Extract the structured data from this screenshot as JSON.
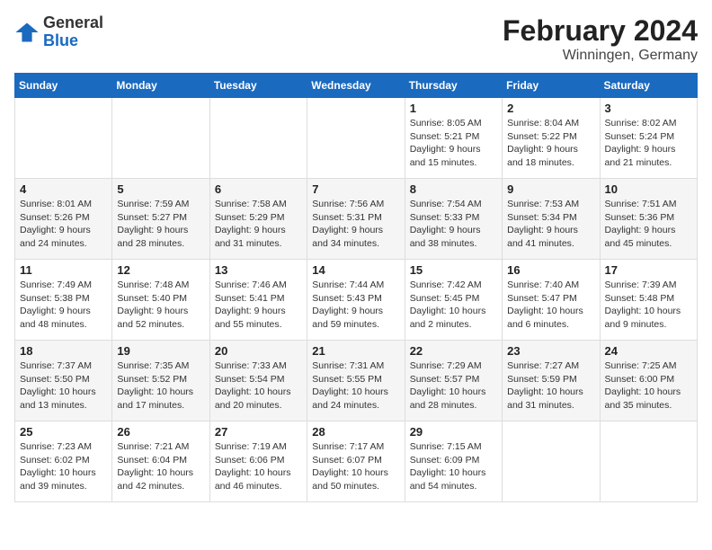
{
  "logo": {
    "text_general": "General",
    "text_blue": "Blue"
  },
  "title": "February 2024",
  "subtitle": "Winningen, Germany",
  "header_days": [
    "Sunday",
    "Monday",
    "Tuesday",
    "Wednesday",
    "Thursday",
    "Friday",
    "Saturday"
  ],
  "weeks": [
    [
      {
        "day": "",
        "info": ""
      },
      {
        "day": "",
        "info": ""
      },
      {
        "day": "",
        "info": ""
      },
      {
        "day": "",
        "info": ""
      },
      {
        "day": "1",
        "info": "Sunrise: 8:05 AM\nSunset: 5:21 PM\nDaylight: 9 hours and 15 minutes."
      },
      {
        "day": "2",
        "info": "Sunrise: 8:04 AM\nSunset: 5:22 PM\nDaylight: 9 hours and 18 minutes."
      },
      {
        "day": "3",
        "info": "Sunrise: 8:02 AM\nSunset: 5:24 PM\nDaylight: 9 hours and 21 minutes."
      }
    ],
    [
      {
        "day": "4",
        "info": "Sunrise: 8:01 AM\nSunset: 5:26 PM\nDaylight: 9 hours and 24 minutes."
      },
      {
        "day": "5",
        "info": "Sunrise: 7:59 AM\nSunset: 5:27 PM\nDaylight: 9 hours and 28 minutes."
      },
      {
        "day": "6",
        "info": "Sunrise: 7:58 AM\nSunset: 5:29 PM\nDaylight: 9 hours and 31 minutes."
      },
      {
        "day": "7",
        "info": "Sunrise: 7:56 AM\nSunset: 5:31 PM\nDaylight: 9 hours and 34 minutes."
      },
      {
        "day": "8",
        "info": "Sunrise: 7:54 AM\nSunset: 5:33 PM\nDaylight: 9 hours and 38 minutes."
      },
      {
        "day": "9",
        "info": "Sunrise: 7:53 AM\nSunset: 5:34 PM\nDaylight: 9 hours and 41 minutes."
      },
      {
        "day": "10",
        "info": "Sunrise: 7:51 AM\nSunset: 5:36 PM\nDaylight: 9 hours and 45 minutes."
      }
    ],
    [
      {
        "day": "11",
        "info": "Sunrise: 7:49 AM\nSunset: 5:38 PM\nDaylight: 9 hours and 48 minutes."
      },
      {
        "day": "12",
        "info": "Sunrise: 7:48 AM\nSunset: 5:40 PM\nDaylight: 9 hours and 52 minutes."
      },
      {
        "day": "13",
        "info": "Sunrise: 7:46 AM\nSunset: 5:41 PM\nDaylight: 9 hours and 55 minutes."
      },
      {
        "day": "14",
        "info": "Sunrise: 7:44 AM\nSunset: 5:43 PM\nDaylight: 9 hours and 59 minutes."
      },
      {
        "day": "15",
        "info": "Sunrise: 7:42 AM\nSunset: 5:45 PM\nDaylight: 10 hours and 2 minutes."
      },
      {
        "day": "16",
        "info": "Sunrise: 7:40 AM\nSunset: 5:47 PM\nDaylight: 10 hours and 6 minutes."
      },
      {
        "day": "17",
        "info": "Sunrise: 7:39 AM\nSunset: 5:48 PM\nDaylight: 10 hours and 9 minutes."
      }
    ],
    [
      {
        "day": "18",
        "info": "Sunrise: 7:37 AM\nSunset: 5:50 PM\nDaylight: 10 hours and 13 minutes."
      },
      {
        "day": "19",
        "info": "Sunrise: 7:35 AM\nSunset: 5:52 PM\nDaylight: 10 hours and 17 minutes."
      },
      {
        "day": "20",
        "info": "Sunrise: 7:33 AM\nSunset: 5:54 PM\nDaylight: 10 hours and 20 minutes."
      },
      {
        "day": "21",
        "info": "Sunrise: 7:31 AM\nSunset: 5:55 PM\nDaylight: 10 hours and 24 minutes."
      },
      {
        "day": "22",
        "info": "Sunrise: 7:29 AM\nSunset: 5:57 PM\nDaylight: 10 hours and 28 minutes."
      },
      {
        "day": "23",
        "info": "Sunrise: 7:27 AM\nSunset: 5:59 PM\nDaylight: 10 hours and 31 minutes."
      },
      {
        "day": "24",
        "info": "Sunrise: 7:25 AM\nSunset: 6:00 PM\nDaylight: 10 hours and 35 minutes."
      }
    ],
    [
      {
        "day": "25",
        "info": "Sunrise: 7:23 AM\nSunset: 6:02 PM\nDaylight: 10 hours and 39 minutes."
      },
      {
        "day": "26",
        "info": "Sunrise: 7:21 AM\nSunset: 6:04 PM\nDaylight: 10 hours and 42 minutes."
      },
      {
        "day": "27",
        "info": "Sunrise: 7:19 AM\nSunset: 6:06 PM\nDaylight: 10 hours and 46 minutes."
      },
      {
        "day": "28",
        "info": "Sunrise: 7:17 AM\nSunset: 6:07 PM\nDaylight: 10 hours and 50 minutes."
      },
      {
        "day": "29",
        "info": "Sunrise: 7:15 AM\nSunset: 6:09 PM\nDaylight: 10 hours and 54 minutes."
      },
      {
        "day": "",
        "info": ""
      },
      {
        "day": "",
        "info": ""
      }
    ]
  ]
}
